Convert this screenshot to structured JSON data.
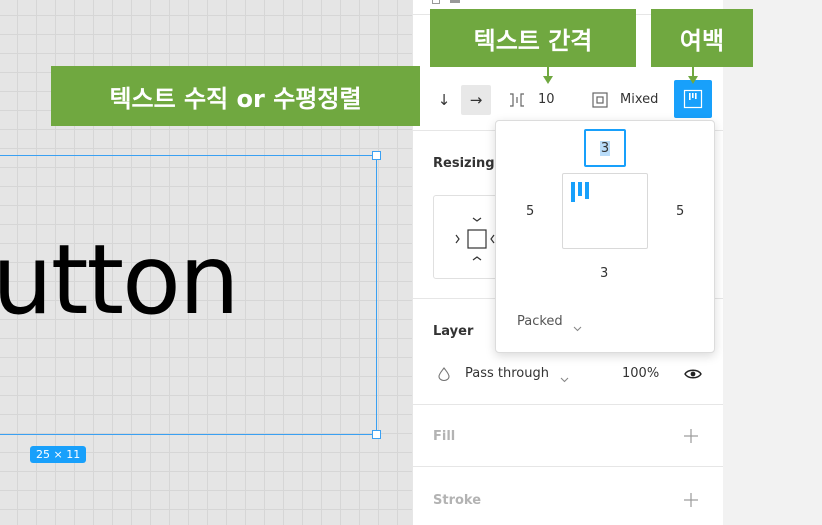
{
  "canvas": {
    "text_fragment": "utton",
    "size_badge": "25 × 11"
  },
  "auto_layout": {
    "direction_down_symbol": "↓",
    "direction_right_symbol": "→",
    "spacing_value": "10",
    "padding_mode": "Mixed"
  },
  "padding_popover": {
    "top": "3",
    "left": "5",
    "right": "5",
    "bottom": "3",
    "alignment": "Packed"
  },
  "sections": {
    "resizing": "Resizing",
    "layer": "Layer",
    "fill": "Fill",
    "stroke": "Stroke"
  },
  "layer": {
    "blend_mode": "Pass through",
    "opacity": "100%"
  },
  "annotations": {
    "spacing": "텍스트 간격",
    "padding": "여백",
    "direction": "텍스트 수직 or 수평정렬"
  },
  "colors": {
    "accent": "#18a0fb",
    "annotation": "#70a840",
    "selection": "#3aa0f2"
  }
}
